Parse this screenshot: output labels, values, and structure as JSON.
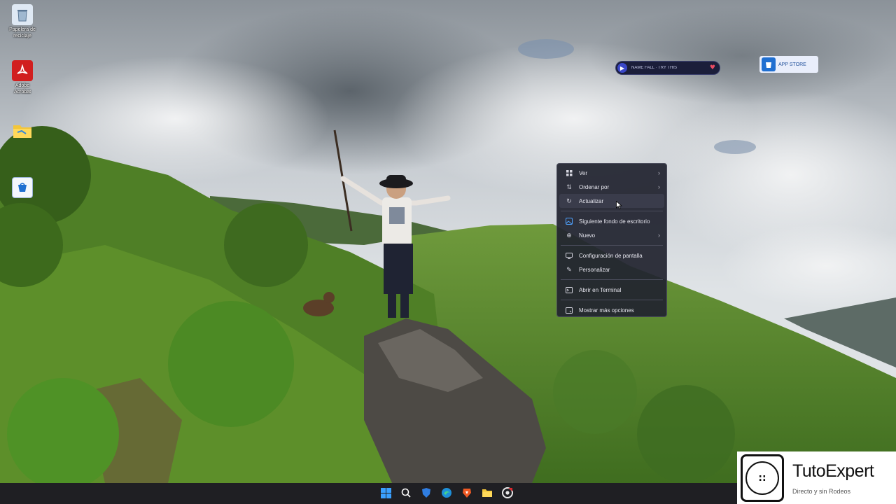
{
  "desktop": {
    "icons": [
      {
        "name": "recycle-bin",
        "label": "Papelera de reciclaje"
      },
      {
        "name": "acrobat",
        "label": "Adobe Acrobat"
      },
      {
        "name": "folder",
        "label": ""
      },
      {
        "name": "store-app",
        "label": ""
      }
    ]
  },
  "widgets": {
    "music": {
      "track": "NAME FALL · TRY THIS"
    },
    "store": {
      "label": "APP STORE"
    }
  },
  "context_menu": {
    "items": [
      {
        "label": "Ver",
        "icon": "grid-icon",
        "submenu": true
      },
      {
        "label": "Ordenar por",
        "icon": "sort-icon",
        "submenu": true
      },
      {
        "label": "Actualizar",
        "icon": "refresh-icon",
        "submenu": false,
        "hovered": true
      },
      {
        "label": "Siguiente fondo de escritorio",
        "icon": "wallpaper-icon",
        "submenu": false
      },
      {
        "label": "Nuevo",
        "icon": "plus-circle-icon",
        "submenu": true
      },
      {
        "label": "Configuración de pantalla",
        "icon": "display-icon",
        "submenu": false
      },
      {
        "label": "Personalizar",
        "icon": "pen-icon",
        "submenu": false
      },
      {
        "label": "Abrir en Terminal",
        "icon": "terminal-icon",
        "submenu": false
      },
      {
        "label": "Mostrar más opciones",
        "icon": "more-icon",
        "submenu": false
      }
    ]
  },
  "watermark": {
    "brand": "TutoExpert",
    "tagline": "Directo y sin Rodeos",
    "logo_glyph": "::"
  },
  "taskbar": {
    "icons": [
      "start-icon",
      "search-icon",
      "shield-app-icon",
      "edge-icon",
      "brave-icon",
      "file-explorer-icon",
      "chrome-app-icon"
    ]
  },
  "colors": {
    "menu_bg": "#21232f",
    "taskbar_bg": "#1f1f23",
    "accent": "#1f6fd1"
  }
}
